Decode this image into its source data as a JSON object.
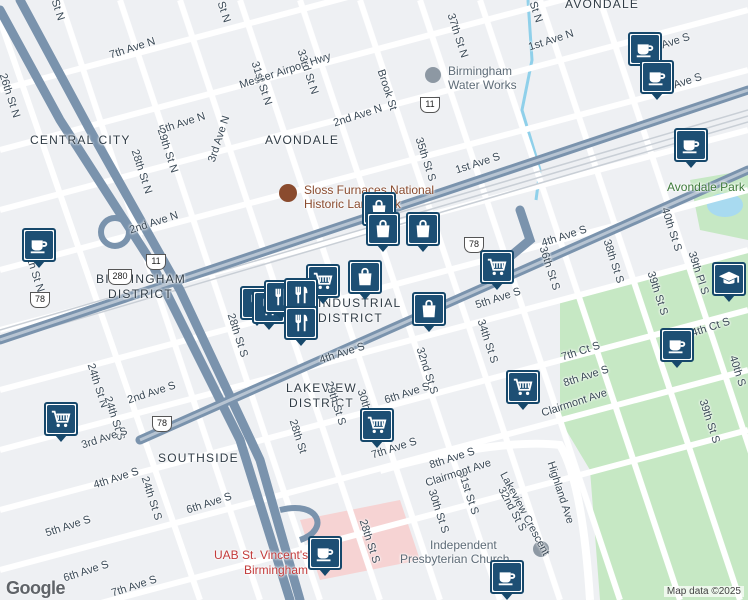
{
  "map": {
    "attribution": "Map data ©2025",
    "logo_text": "Google",
    "colors": {
      "water": "#a8daf0",
      "park": "#c6e8c4",
      "highway": "#7a93ad",
      "hospital": "#f6d3d3",
      "pin_border": "#16486b"
    }
  },
  "districts": [
    {
      "id": "central-city",
      "text": "CENTRAL CITY"
    },
    {
      "id": "avondale-mid",
      "text": "AVONDALE"
    },
    {
      "id": "avondale-top",
      "text": "AVONDALE"
    },
    {
      "id": "birmingham-1",
      "text": "BIRMINGHAM"
    },
    {
      "id": "birmingham-2",
      "text": "DISTRICT"
    },
    {
      "id": "industrial-1",
      "text": "INDUSTRIAL"
    },
    {
      "id": "industrial-2",
      "text": "DISTRICT"
    },
    {
      "id": "lakeview-1",
      "text": "LAKEVIEW"
    },
    {
      "id": "lakeview-2",
      "text": "DISTRICT"
    },
    {
      "id": "southside",
      "text": "SOUTHSIDE"
    }
  ],
  "streets": [
    {
      "id": "s1",
      "text": "7th Ave N"
    },
    {
      "id": "s2",
      "text": "Messer Airport Hwy"
    },
    {
      "id": "s3",
      "text": "5th Ave N"
    },
    {
      "id": "s4",
      "text": "29th St N"
    },
    {
      "id": "s5",
      "text": "3rd Ave N"
    },
    {
      "id": "s6",
      "text": "28th St N"
    },
    {
      "id": "s7",
      "text": "31st St N"
    },
    {
      "id": "s8",
      "text": "33rd St N"
    },
    {
      "id": "s9",
      "text": "2nd Ave N"
    },
    {
      "id": "s10",
      "text": "26th St N"
    },
    {
      "id": "s11",
      "text": "2nd Ave N"
    },
    {
      "id": "s12",
      "text": "24th St N"
    },
    {
      "id": "s13",
      "text": "24th St S"
    },
    {
      "id": "s14",
      "text": "2nd Ave S"
    },
    {
      "id": "s15",
      "text": "3rd Ave S"
    },
    {
      "id": "s16",
      "text": "4th Ave S"
    },
    {
      "id": "s17",
      "text": "24th St S"
    },
    {
      "id": "s18",
      "text": "6th Ave S"
    },
    {
      "id": "s19",
      "text": "5th Ave S"
    },
    {
      "id": "s20",
      "text": "6th Ave S"
    },
    {
      "id": "s21",
      "text": "7th Ave S"
    },
    {
      "id": "s22",
      "text": "28th St S"
    },
    {
      "id": "s23",
      "text": "28th St"
    },
    {
      "id": "s24",
      "text": "4th Ave S"
    },
    {
      "id": "s25",
      "text": "28th St S"
    },
    {
      "id": "s26",
      "text": "30th St S"
    },
    {
      "id": "s27",
      "text": "6th Ave S"
    },
    {
      "id": "s28",
      "text": "7th Ave S"
    },
    {
      "id": "s29",
      "text": "32nd St S"
    },
    {
      "id": "s30",
      "text": "30th St S"
    },
    {
      "id": "s31",
      "text": "31st St S"
    },
    {
      "id": "s32",
      "text": "8th Ave S"
    },
    {
      "id": "s33",
      "text": "Clairmont Ave"
    },
    {
      "id": "s34",
      "text": "Clairmont Ave"
    },
    {
      "id": "s35",
      "text": "Lakeview Crescent"
    },
    {
      "id": "s36",
      "text": "32nd St S"
    },
    {
      "id": "s37",
      "text": "Highland Ave"
    },
    {
      "id": "s38",
      "text": "34th St S"
    },
    {
      "id": "s39",
      "text": "5th Ave S"
    },
    {
      "id": "s40",
      "text": "36th St S"
    },
    {
      "id": "s41",
      "text": "4th Ave S"
    },
    {
      "id": "s42",
      "text": "7th Ct S"
    },
    {
      "id": "s43",
      "text": "8th Ave S"
    },
    {
      "id": "s44",
      "text": "38th St S"
    },
    {
      "id": "s45",
      "text": "40th St S"
    },
    {
      "id": "s46",
      "text": "39th St S"
    },
    {
      "id": "s47",
      "text": "39th Pl S"
    },
    {
      "id": "s48",
      "text": "4th Ct S"
    },
    {
      "id": "s49",
      "text": "39th St S"
    },
    {
      "id": "s50",
      "text": "40th S"
    },
    {
      "id": "s51",
      "text": "35th St S"
    },
    {
      "id": "s52",
      "text": "1st Ave S"
    },
    {
      "id": "s53",
      "text": "Brook St"
    },
    {
      "id": "s54",
      "text": "37th St N"
    },
    {
      "id": "s55",
      "text": "1st Ave N"
    },
    {
      "id": "s56",
      "text": "3rd Ave S"
    },
    {
      "id": "s57",
      "text": "Ave S"
    },
    {
      "id": "s58",
      "text": "St N"
    },
    {
      "id": "s59",
      "text": "St N"
    },
    {
      "id": "s60",
      "text": "St N"
    },
    {
      "id": "s61",
      "text": "th St N"
    },
    {
      "id": "s62",
      "text": "29th St S"
    }
  ],
  "places": [
    {
      "id": "water-works-1",
      "text": "Birmingham"
    },
    {
      "id": "water-works-2",
      "text": "Water Works"
    },
    {
      "id": "sloss-1",
      "text": "Sloss Furnaces National"
    },
    {
      "id": "sloss-2",
      "text": "Historic Landmark"
    },
    {
      "id": "avondale-park",
      "text": "Avondale Park"
    },
    {
      "id": "church-1",
      "text": "Independent"
    },
    {
      "id": "church-2",
      "text": "Presbyterian Church"
    },
    {
      "id": "uab-1",
      "text": "UAB St. Vincent's"
    },
    {
      "id": "uab-2",
      "text": "Birmingham"
    }
  ],
  "shields": [
    {
      "id": "us11-a",
      "text": "11"
    },
    {
      "id": "us11-b",
      "text": "11"
    },
    {
      "id": "us78-a",
      "text": "78"
    },
    {
      "id": "us78-b",
      "text": "78"
    },
    {
      "id": "us78-c",
      "text": "78"
    },
    {
      "id": "us280",
      "text": "280"
    }
  ],
  "pins": [
    {
      "id": "cafe-1",
      "icon": "coffee-icon"
    },
    {
      "id": "cafe-2",
      "icon": "coffee-icon"
    },
    {
      "id": "cafe-3",
      "icon": "coffee-icon"
    },
    {
      "id": "cafe-4",
      "icon": "coffee-icon"
    },
    {
      "id": "cafe-5",
      "icon": "coffee-icon"
    },
    {
      "id": "cafe-6",
      "icon": "coffee-icon"
    },
    {
      "id": "cafe-7",
      "icon": "coffee-icon"
    },
    {
      "id": "shop-1",
      "icon": "shopping-bag-icon"
    },
    {
      "id": "shop-2",
      "icon": "shopping-bag-icon"
    },
    {
      "id": "shop-3",
      "icon": "shopping-bag-icon"
    },
    {
      "id": "shop-4",
      "icon": "shopping-bag-icon"
    },
    {
      "id": "shop-5",
      "icon": "shopping-bag-icon"
    },
    {
      "id": "cart-1",
      "icon": "shopping-cart-icon"
    },
    {
      "id": "cart-2",
      "icon": "shopping-cart-icon"
    },
    {
      "id": "cart-3",
      "icon": "shopping-cart-icon"
    },
    {
      "id": "cart-4",
      "icon": "shopping-cart-icon"
    },
    {
      "id": "cart-5",
      "icon": "shopping-cart-icon"
    },
    {
      "id": "food-1",
      "icon": "fork-knife-icon"
    },
    {
      "id": "food-2",
      "icon": "fork-knife-icon"
    },
    {
      "id": "food-3",
      "icon": "fork-knife-icon"
    },
    {
      "id": "food-4",
      "icon": "fork-knife-icon"
    },
    {
      "id": "food-5",
      "icon": "fork-knife-icon"
    },
    {
      "id": "school-1",
      "icon": "graduation-cap-icon"
    }
  ]
}
